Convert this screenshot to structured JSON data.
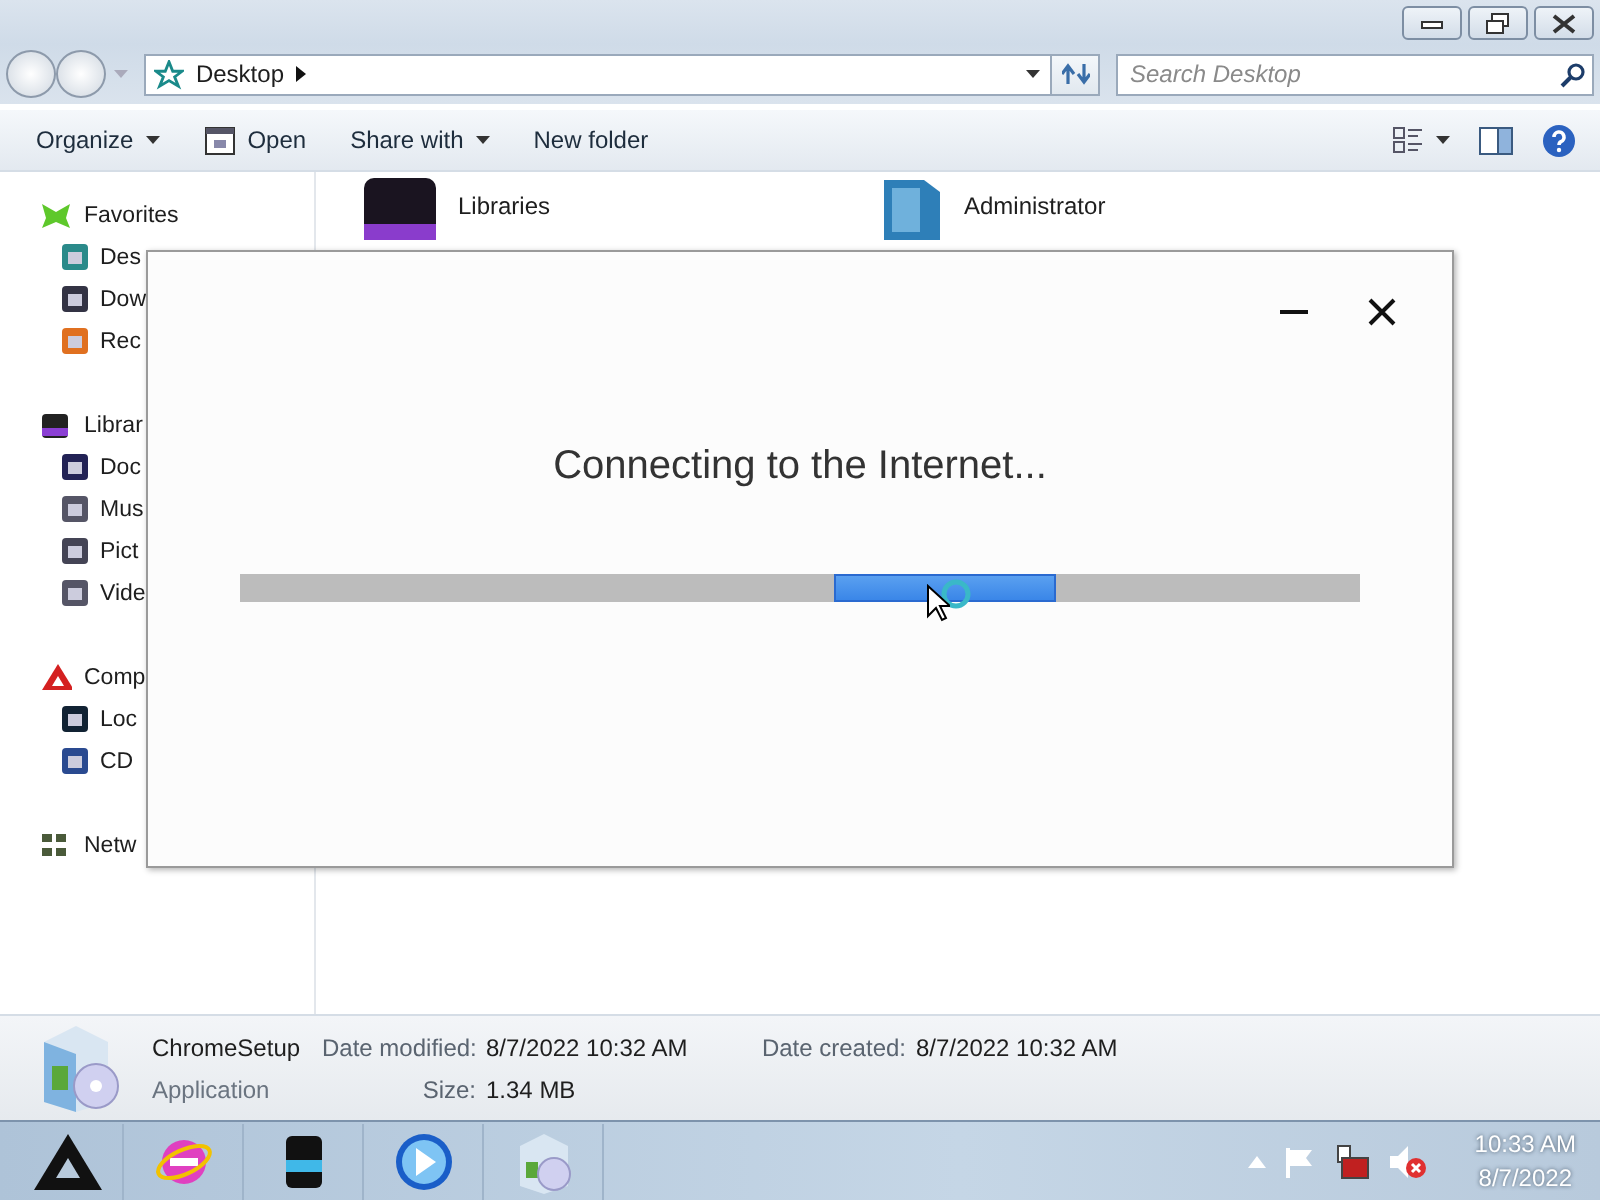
{
  "address_bar": {
    "path": "Desktop",
    "search": {
      "placeholder": "Search Desktop"
    }
  },
  "toolbar": {
    "items": [
      {
        "label": "Organize",
        "dropdown": true
      },
      {
        "label": "Open",
        "dropdown": false
      },
      {
        "label": "Share with",
        "dropdown": true
      },
      {
        "label": "New folder",
        "dropdown": false
      }
    ]
  },
  "nav_pane": {
    "groups": [
      {
        "label": "Favorites",
        "children": [
          {
            "label": "Des"
          },
          {
            "label": "Dow"
          },
          {
            "label": "Rec"
          }
        ]
      },
      {
        "label": "Librar",
        "children": [
          {
            "label": "Doc"
          },
          {
            "label": "Mus"
          },
          {
            "label": "Pict"
          },
          {
            "label": "Vide"
          }
        ]
      },
      {
        "label": "Comp",
        "children": [
          {
            "label": "Loc"
          },
          {
            "label": "CD"
          }
        ]
      },
      {
        "label": "Netw"
      }
    ]
  },
  "content": {
    "items": [
      {
        "name": "Libraries"
      },
      {
        "name": "Administrator"
      }
    ]
  },
  "dialog": {
    "message": "Connecting to the Internet..."
  },
  "details": {
    "name": "ChromeSetup",
    "type": "Application",
    "fields": [
      {
        "label": "Date modified:",
        "value": "8/7/2022 10:32 AM"
      },
      {
        "label": "Size:",
        "value": "1.34 MB"
      },
      {
        "label": "Date created:",
        "value": "8/7/2022 10:32 AM"
      }
    ]
  },
  "taskbar": {
    "clock": {
      "time": "10:33 AM",
      "date": "8/7/2022"
    }
  }
}
